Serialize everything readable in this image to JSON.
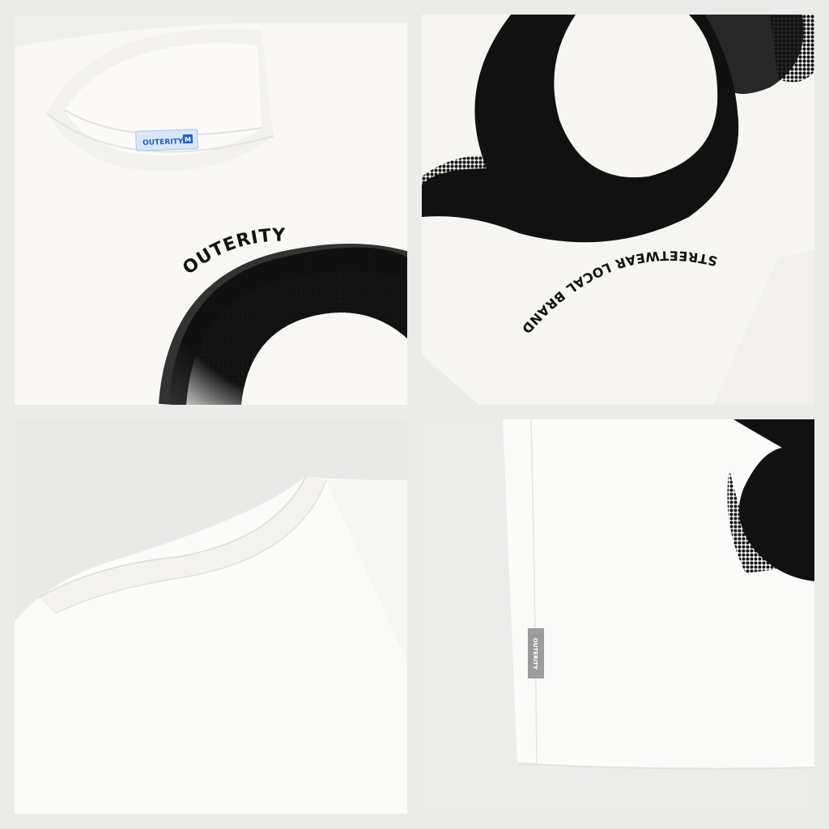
{
  "collage": {
    "panels": [
      {
        "id": "front-collar-print",
        "neck_label": "OUTERITY",
        "neck_label_size": "M",
        "print_text": "OUTERITY"
      },
      {
        "id": "back-print-closeup",
        "print_text": "STREETWEAR LOCAL BRAND"
      },
      {
        "id": "back-collar-closeup"
      },
      {
        "id": "side-hem-tag",
        "side_tag": "OUTERITY"
      }
    ]
  },
  "colors": {
    "shirt": "#f8f7f4",
    "background": "#ebebea",
    "print": "#111111",
    "neck_label": "#d8e6f7",
    "neck_label_text": "#1f5fbf",
    "side_tag": "#9a9c9e"
  }
}
